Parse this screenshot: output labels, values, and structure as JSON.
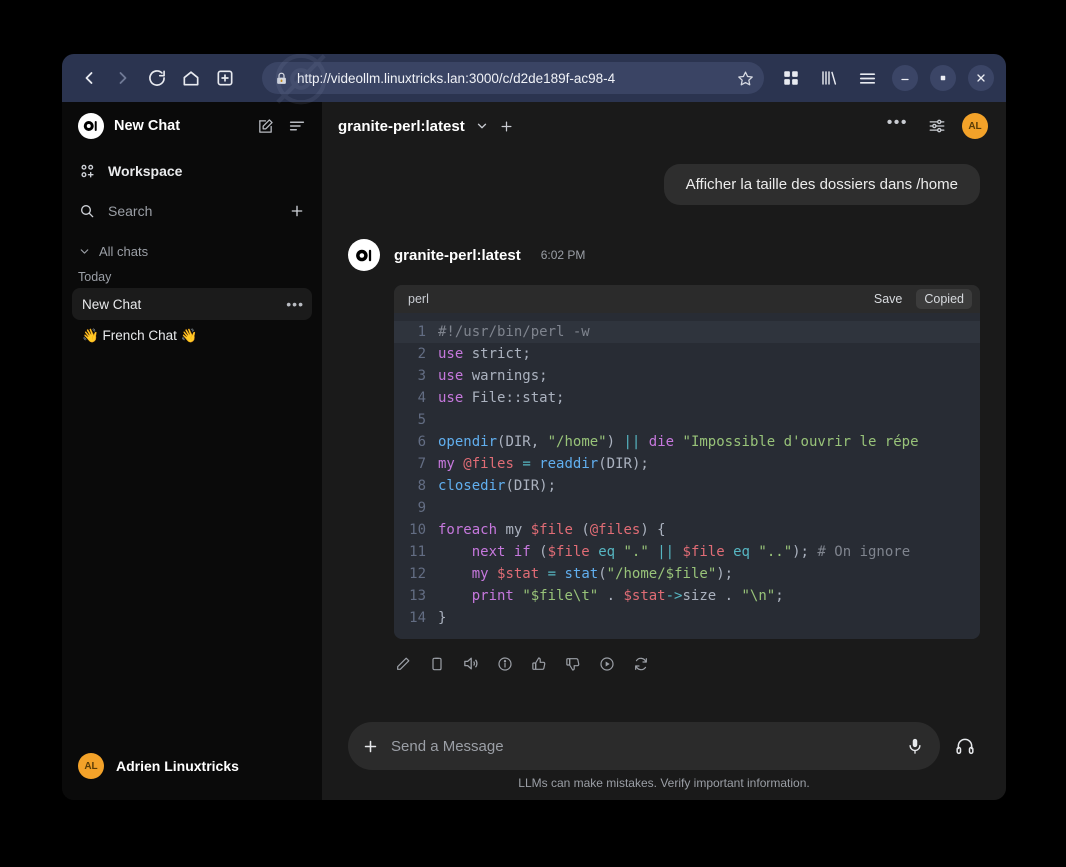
{
  "browser": {
    "url": "http://videollm.linuxtricks.lan:3000/c/d2de189f-ac98-4",
    "nav": {
      "back": "back-arrow",
      "forward": "forward-arrow",
      "reload": "reload",
      "home": "home",
      "newtab": "new-tab"
    },
    "right_icons": [
      "grid-apps",
      "library",
      "menu"
    ],
    "window_controls": [
      "minimize",
      "maximize",
      "close"
    ]
  },
  "sidebar": {
    "title": "New Chat",
    "logo": "open-webui-logo",
    "head_icons": [
      "new-chat-pencil",
      "toggle-sidebar"
    ],
    "workspace_label": "Workspace",
    "search_placeholder": "Search",
    "new_chat_plus": "+",
    "all_chats_label": "All chats",
    "today_label": "Today",
    "chats": [
      {
        "label": "New Chat",
        "active": true,
        "more": "•••"
      },
      {
        "label": "👋 French Chat 👋",
        "active": false,
        "more": ""
      }
    ],
    "user": {
      "initials": "AL",
      "name": "Adrien Linuxtricks"
    }
  },
  "main": {
    "model_name": "granite-perl:latest",
    "model_chevron": "chevron-down-icon",
    "add_model": "+",
    "header_icons": [
      "more-dots",
      "chat-controls",
      "user-avatar"
    ],
    "header_avatar_initials": "AL",
    "user_message": "Afficher la taille des dossiers dans /home",
    "assistant": {
      "name": "granite-perl:latest",
      "time": "6:02 PM",
      "logo": "open-webui-logo"
    },
    "code": {
      "language": "perl",
      "save_label": "Save",
      "copy_label": "Copied",
      "lines": [
        {
          "n": "1",
          "highlight": true,
          "tokens": [
            {
              "t": "#!/usr/bin/perl -w",
              "c": "t-com"
            }
          ]
        },
        {
          "n": "2",
          "highlight": false,
          "tokens": [
            {
              "t": "use",
              "c": "t-kw"
            },
            {
              "t": " strict",
              "c": "t-pl"
            },
            {
              "t": ";",
              "c": "t-punc"
            }
          ]
        },
        {
          "n": "3",
          "highlight": false,
          "tokens": [
            {
              "t": "use",
              "c": "t-kw"
            },
            {
              "t": " warnings",
              "c": "t-pl"
            },
            {
              "t": ";",
              "c": "t-punc"
            }
          ]
        },
        {
          "n": "4",
          "highlight": false,
          "tokens": [
            {
              "t": "use",
              "c": "t-kw"
            },
            {
              "t": " File::stat",
              "c": "t-pl"
            },
            {
              "t": ";",
              "c": "t-punc"
            }
          ]
        },
        {
          "n": "5",
          "highlight": false,
          "tokens": []
        },
        {
          "n": "6",
          "highlight": false,
          "tokens": [
            {
              "t": "opendir",
              "c": "t-fn"
            },
            {
              "t": "(",
              "c": "t-punc"
            },
            {
              "t": "DIR",
              "c": "t-pl"
            },
            {
              "t": ", ",
              "c": "t-punc"
            },
            {
              "t": "\"/home\"",
              "c": "t-str"
            },
            {
              "t": ") ",
              "c": "t-punc"
            },
            {
              "t": "||",
              "c": "t-op"
            },
            {
              "t": " ",
              "c": "t-punc"
            },
            {
              "t": "die",
              "c": "t-kw"
            },
            {
              "t": " ",
              "c": "t-punc"
            },
            {
              "t": "\"Impossible d'ouvrir le répe",
              "c": "t-str"
            }
          ]
        },
        {
          "n": "7",
          "highlight": false,
          "tokens": [
            {
              "t": "my",
              "c": "t-kw"
            },
            {
              "t": " ",
              "c": "t-punc"
            },
            {
              "t": "@files",
              "c": "t-var"
            },
            {
              "t": " ",
              "c": "t-punc"
            },
            {
              "t": "=",
              "c": "t-op"
            },
            {
              "t": " ",
              "c": "t-punc"
            },
            {
              "t": "readdir",
              "c": "t-fn"
            },
            {
              "t": "(",
              "c": "t-punc"
            },
            {
              "t": "DIR",
              "c": "t-pl"
            },
            {
              "t": ");",
              "c": "t-punc"
            }
          ]
        },
        {
          "n": "8",
          "highlight": false,
          "tokens": [
            {
              "t": "closedir",
              "c": "t-fn"
            },
            {
              "t": "(",
              "c": "t-punc"
            },
            {
              "t": "DIR",
              "c": "t-pl"
            },
            {
              "t": ");",
              "c": "t-punc"
            }
          ]
        },
        {
          "n": "9",
          "highlight": false,
          "tokens": []
        },
        {
          "n": "10",
          "highlight": false,
          "tokens": [
            {
              "t": "foreach",
              "c": "t-kw"
            },
            {
              "t": " my ",
              "c": "t-pl"
            },
            {
              "t": "$file",
              "c": "t-var"
            },
            {
              "t": " (",
              "c": "t-punc"
            },
            {
              "t": "@files",
              "c": "t-var"
            },
            {
              "t": ") {",
              "c": "t-punc"
            }
          ]
        },
        {
          "n": "11",
          "highlight": false,
          "tokens": [
            {
              "t": "    ",
              "c": "t-punc"
            },
            {
              "t": "next",
              "c": "t-kw"
            },
            {
              "t": " ",
              "c": "t-punc"
            },
            {
              "t": "if",
              "c": "t-kw"
            },
            {
              "t": " (",
              "c": "t-punc"
            },
            {
              "t": "$file",
              "c": "t-var"
            },
            {
              "t": " ",
              "c": "t-punc"
            },
            {
              "t": "eq",
              "c": "t-op"
            },
            {
              "t": " ",
              "c": "t-punc"
            },
            {
              "t": "\".\"",
              "c": "t-str"
            },
            {
              "t": " ",
              "c": "t-punc"
            },
            {
              "t": "||",
              "c": "t-op"
            },
            {
              "t": " ",
              "c": "t-punc"
            },
            {
              "t": "$file",
              "c": "t-var"
            },
            {
              "t": " ",
              "c": "t-punc"
            },
            {
              "t": "eq",
              "c": "t-op"
            },
            {
              "t": " ",
              "c": "t-punc"
            },
            {
              "t": "\"..\"",
              "c": "t-str"
            },
            {
              "t": "); ",
              "c": "t-punc"
            },
            {
              "t": "# On ignore",
              "c": "t-com"
            }
          ]
        },
        {
          "n": "12",
          "highlight": false,
          "tokens": [
            {
              "t": "    ",
              "c": "t-punc"
            },
            {
              "t": "my",
              "c": "t-kw"
            },
            {
              "t": " ",
              "c": "t-punc"
            },
            {
              "t": "$stat",
              "c": "t-var"
            },
            {
              "t": " ",
              "c": "t-punc"
            },
            {
              "t": "=",
              "c": "t-op"
            },
            {
              "t": " ",
              "c": "t-punc"
            },
            {
              "t": "stat",
              "c": "t-fn"
            },
            {
              "t": "(",
              "c": "t-punc"
            },
            {
              "t": "\"/home/",
              "c": "t-str"
            },
            {
              "t": "$file",
              "c": "t-str"
            },
            {
              "t": "\"",
              "c": "t-str"
            },
            {
              "t": ");",
              "c": "t-punc"
            }
          ]
        },
        {
          "n": "13",
          "highlight": false,
          "tokens": [
            {
              "t": "    ",
              "c": "t-punc"
            },
            {
              "t": "print",
              "c": "t-kw"
            },
            {
              "t": " ",
              "c": "t-punc"
            },
            {
              "t": "\"$file\\t\"",
              "c": "t-str"
            },
            {
              "t": " . ",
              "c": "t-punc"
            },
            {
              "t": "$stat",
              "c": "t-var"
            },
            {
              "t": "->",
              "c": "t-op"
            },
            {
              "t": "size",
              "c": "t-pl"
            },
            {
              "t": " . ",
              "c": "t-punc"
            },
            {
              "t": "\"\\n\"",
              "c": "t-str"
            },
            {
              "t": ";",
              "c": "t-punc"
            }
          ]
        },
        {
          "n": "14",
          "highlight": false,
          "tokens": [
            {
              "t": "}",
              "c": "t-punc"
            }
          ]
        }
      ]
    },
    "message_actions": [
      "edit-pencil-icon",
      "copy-icon",
      "speaker-icon",
      "info-icon",
      "thumbs-up-icon",
      "thumbs-down-icon",
      "continue-play-icon",
      "regenerate-icon"
    ],
    "composer": {
      "plus_icon": "plus-icon",
      "placeholder": "Send a Message",
      "mic_icon": "microphone-icon",
      "headset_icon": "headset-icon"
    },
    "disclaimer": "LLMs can make mistakes. Verify important information."
  },
  "colors": {
    "accent": "#f3a229",
    "toolbar_bg": "#2b3450",
    "sidebar_bg": "#0a0a0a",
    "main_bg": "#1a1a1a",
    "code_bg": "#282c34"
  }
}
